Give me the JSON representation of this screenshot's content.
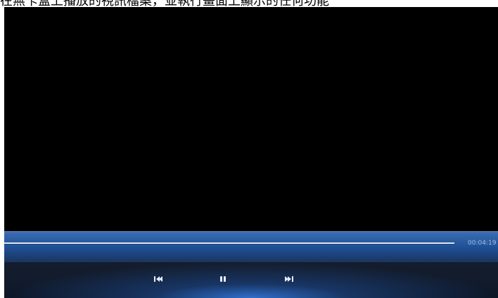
{
  "caption": {
    "text": "在無卡盒上播放的視訊檔案，並執行畫面上顯示的任何功能"
  },
  "player": {
    "time": "00:04:19",
    "progress": 1.0
  },
  "controls": {
    "previous_icon": "previous-track-icon",
    "pause_icon": "pause-icon",
    "next_icon": "next-track-icon",
    "accent_color": "#2f6fc9",
    "time_color": "#9fc1f2"
  }
}
